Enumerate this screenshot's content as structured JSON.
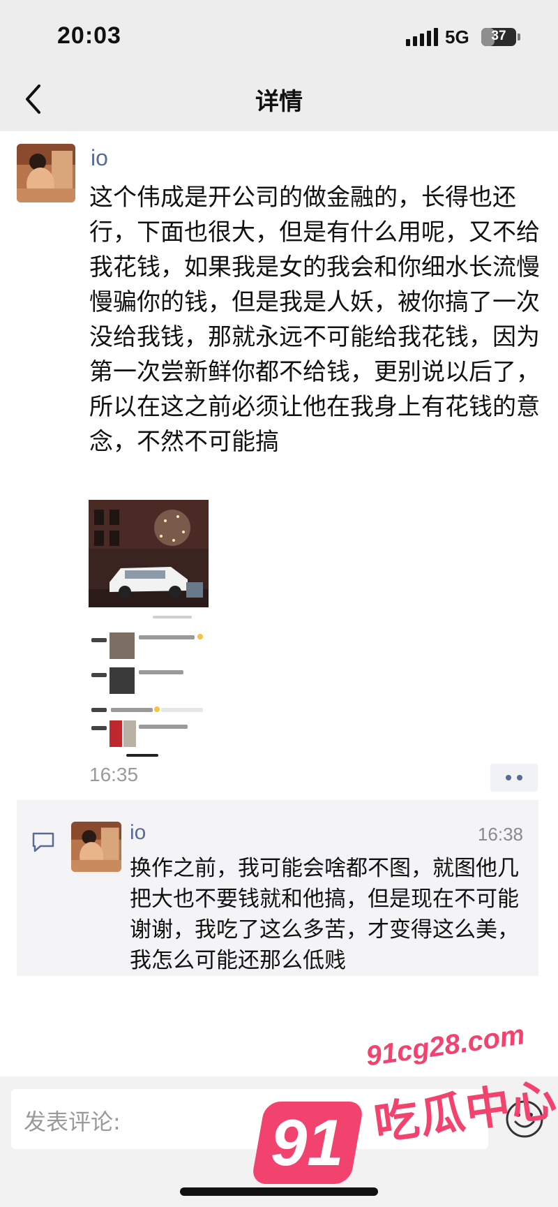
{
  "status_bar": {
    "time": "20:03",
    "network": "5G",
    "battery": "37",
    "battery_level": 0.37
  },
  "nav": {
    "title": "详情",
    "back_icon": "chevron-left-icon"
  },
  "post": {
    "author": "io",
    "content": "这个伟成是开公司的做金融的，长得也还行，下面也很大，但是有什么用呢，又不给我花钱，如果我是女的我会和你细水长流慢慢骗你的钱，但是我是人妖，被你搞了一次没给我钱，那就永远不可能给我花钱，因为第一次尝新鲜你都不给钱，更别说以后了，所以在这之前必须让他在我身上有花钱的意念，不然不可能搞",
    "time": "16:35"
  },
  "comment": {
    "author": "io",
    "time": "16:38",
    "text": "换作之前，我可能会啥都不图，就图他几把大也不要钱就和他搞，但是现在不可能谢谢，我吃了这么多苦，才变得这么美，我怎么可能还那么低贱"
  },
  "composer": {
    "placeholder": "发表评论:"
  },
  "watermark": {
    "number": "91",
    "url": "91cg28.com",
    "name": "吃瓜中心"
  },
  "colors": {
    "link": "#576b95",
    "watermark": "#f2436f",
    "bar_bg": "#ededed"
  }
}
